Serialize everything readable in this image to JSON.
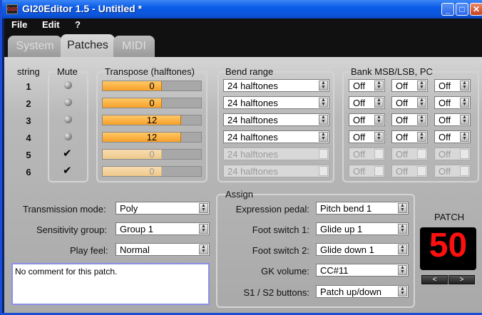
{
  "window": {
    "title": "GI20Editor 1.5 - Untitled *",
    "icon": "GI20"
  },
  "title_buttons": {
    "minimize": "_",
    "maximize": "□",
    "close": "✕"
  },
  "menu": {
    "items": [
      "File",
      "Edit",
      "?"
    ]
  },
  "tabs": [
    {
      "label": "System",
      "active": false
    },
    {
      "label": "Patches",
      "active": true
    },
    {
      "label": "MIDI",
      "active": false
    }
  ],
  "strings": {
    "string_label": "string",
    "mute_label": "Mute",
    "transpose_label": "Transpose (halftones)",
    "bend_label": "Bend range",
    "bank_label": "Bank MSB/LSB, PC",
    "rows": [
      {
        "num": "1",
        "mute": false,
        "transpose": "0",
        "transpose_fill": 0.6,
        "bend": "24 halftones",
        "bank": [
          "Off",
          "Off",
          "Off"
        ],
        "enabled": true
      },
      {
        "num": "2",
        "mute": false,
        "transpose": "0",
        "transpose_fill": 0.6,
        "bend": "24 halftones",
        "bank": [
          "Off",
          "Off",
          "Off"
        ],
        "enabled": true
      },
      {
        "num": "3",
        "mute": false,
        "transpose": "12",
        "transpose_fill": 0.8,
        "bend": "24 halftones",
        "bank": [
          "Off",
          "Off",
          "Off"
        ],
        "enabled": true
      },
      {
        "num": "4",
        "mute": false,
        "transpose": "12",
        "transpose_fill": 0.8,
        "bend": "24 halftones",
        "bank": [
          "Off",
          "Off",
          "Off"
        ],
        "enabled": true
      },
      {
        "num": "5",
        "mute": true,
        "transpose": "0",
        "transpose_fill": 0.6,
        "bend": "24 halftones",
        "bank": [
          "Off",
          "Off",
          "Off"
        ],
        "enabled": false
      },
      {
        "num": "6",
        "mute": true,
        "transpose": "0",
        "transpose_fill": 0.6,
        "bend": "24 halftones",
        "bank": [
          "Off",
          "Off",
          "Off"
        ],
        "enabled": false
      }
    ]
  },
  "settings": {
    "transmission_label": "Transmission mode:",
    "transmission_value": "Poly",
    "sensitivity_label": "Sensitivity group:",
    "sensitivity_value": "Group 1",
    "playfeel_label": "Play feel:",
    "playfeel_value": "Normal"
  },
  "comment": {
    "value": "No comment for this patch."
  },
  "assign": {
    "title": "Assign",
    "rows": [
      {
        "label": "Expression pedal:",
        "value": "Pitch bend 1"
      },
      {
        "label": "Foot switch 1:",
        "value": "Glide up 1"
      },
      {
        "label": "Foot switch 2:",
        "value": "Glide down 1"
      },
      {
        "label": "GK volume:",
        "value": "CC#11"
      },
      {
        "label": "S1 / S2 buttons:",
        "value": "Patch up/down"
      }
    ]
  },
  "patch": {
    "label": "PATCH",
    "number": "50",
    "prev": "<",
    "next": ">"
  },
  "colors": {
    "accent_fill": "#f7a12a",
    "patch_number": "#ff1010",
    "titlebar": "#0a5ce8"
  }
}
